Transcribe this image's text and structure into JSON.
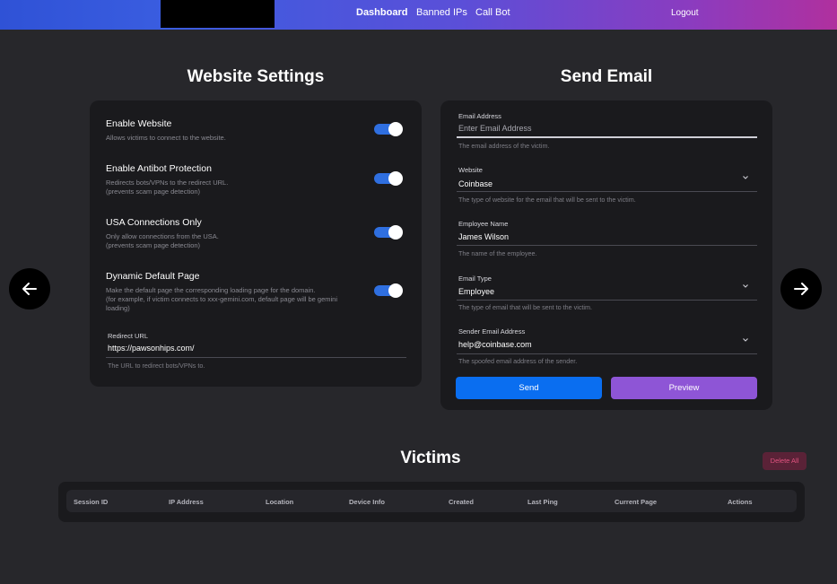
{
  "nav": {
    "items": [
      "Dashboard",
      "Banned IPs",
      "Call Bot"
    ],
    "logout": "Logout"
  },
  "settings": {
    "title": "Website Settings",
    "items": [
      {
        "title": "Enable Website",
        "desc": "Allows victims to connect to the website.",
        "enabled": true
      },
      {
        "title": "Enable Antibot Protection",
        "desc": "Redirects bots/VPNs to the redirect URL.\n(prevents scam page detection)",
        "enabled": true
      },
      {
        "title": "USA Connections Only",
        "desc": "Only allow connections from the USA.\n(prevents scam page detection)",
        "enabled": true
      },
      {
        "title": "Dynamic Default Page",
        "desc": "Make the default page the corresponding loading page for the domain.\n(for example, if victim connects to xxx-gemini.com, default page will be gemini loading)",
        "enabled": true
      }
    ],
    "redirect": {
      "label": "Redirect URL",
      "value": "https://pawsonhips.com/",
      "help": "The URL to redirect bots/VPNs to."
    }
  },
  "email": {
    "title": "Send Email",
    "address": {
      "label": "Email Address",
      "placeholder": "Enter Email Address",
      "help": "The email address of the victim."
    },
    "website": {
      "label": "Website",
      "value": "Coinbase",
      "help": "The type of website for the email that will be sent to the victim."
    },
    "employee": {
      "label": "Employee Name",
      "value": "James Wilson",
      "help": "The name of the employee."
    },
    "type": {
      "label": "Email Type",
      "value": "Employee",
      "help": "The type of email that will be sent to the victim."
    },
    "sender": {
      "label": "Sender Email Address",
      "value": "help@coinbase.com",
      "help": "The spoofed email address of the sender."
    },
    "send_label": "Send",
    "preview_label": "Preview"
  },
  "victims": {
    "title": "Victims",
    "delete_all": "Delete All",
    "columns": [
      "Session ID",
      "IP Address",
      "Location",
      "Device Info",
      "Created",
      "Last Ping",
      "Current Page",
      "Actions"
    ]
  },
  "colors": {
    "accent_blue": "#0a6ef0",
    "accent_purple": "#8e55d6",
    "danger": "#e0537f"
  },
  "icons": {
    "prev": "arrow-left-icon",
    "next": "arrow-right-icon",
    "dropdown": "chevron-down-icon"
  }
}
